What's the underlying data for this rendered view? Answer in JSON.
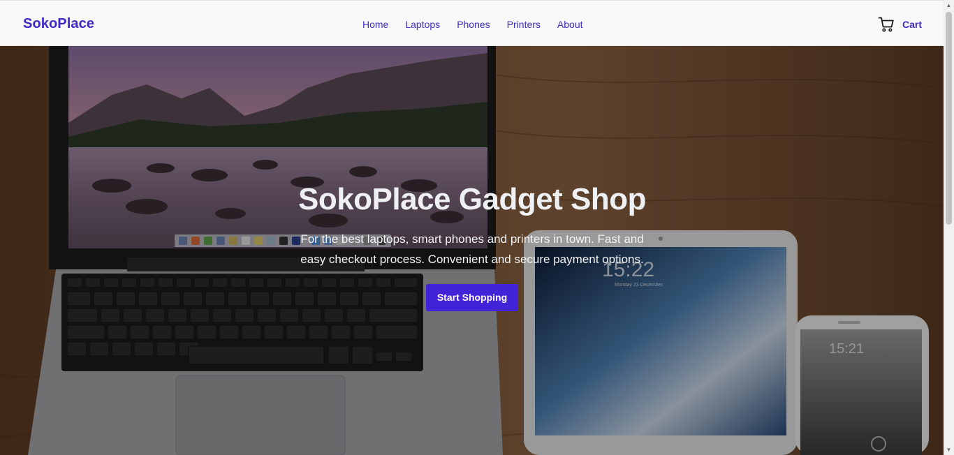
{
  "navbar": {
    "brand": "SokoPlace",
    "links": [
      {
        "label": "Home"
      },
      {
        "label": "Laptops"
      },
      {
        "label": "Phones"
      },
      {
        "label": "Printers"
      },
      {
        "label": "About"
      }
    ],
    "cart_label": "Cart",
    "cart_icon": "shopping-cart-icon"
  },
  "hero": {
    "title": "SokoPlace Gadget Shop",
    "text": "For the best laptops, smart phones and printers in town. Fast and easy checkout process. Convenient and secure payment options.",
    "button_label": "Start Shopping",
    "background_description_icon": "laptop-tablet-phone-photo",
    "tablet_time": "15:22",
    "tablet_date": "Monday 23 December",
    "phone_time": "15:21"
  },
  "colors": {
    "brand": "#4328c9",
    "link": "#3d2fc0",
    "button": "#4323d8",
    "navbar_bg": "#f8f8f9"
  }
}
